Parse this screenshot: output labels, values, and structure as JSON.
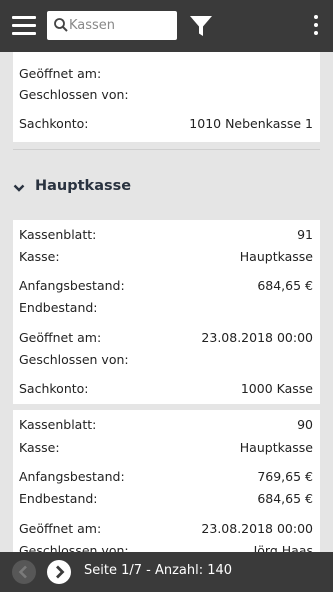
{
  "search": {
    "placeholder": "Kassen",
    "value": ""
  },
  "icons": {
    "menu": "hamburger-menu-icon",
    "search": "magnifier-icon",
    "filter": "funnel-icon",
    "more": "vertical-dots-icon",
    "section": "chevron-down-icon",
    "prev": "chevron-left-icon",
    "next": "chevron-right-icon"
  },
  "colors": {
    "topbar": "#3a3a3a",
    "background": "#e5e5e5",
    "card": "#ffffff",
    "section_title": "#2a3340"
  },
  "prev_card": {
    "opened_label": "Geöffnet am:",
    "closed_by_label": "Geschlossen von:",
    "account_label": "Sachkonto:",
    "account_value": "1010 Nebenkasse 1"
  },
  "section": {
    "title": "Hauptkasse"
  },
  "cards": [
    {
      "sheet_label": "Kassenblatt:",
      "sheet_value": "91",
      "register_label": "Kasse:",
      "register_value": "Hauptkasse",
      "opening_label": "Anfangsbestand:",
      "opening_value": "684,65 €",
      "ending_label": "Endbestand:",
      "ending_value": "",
      "opened_label": "Geöffnet am:",
      "opened_value": "23.08.2018 00:00",
      "closed_by_label": "Geschlossen von:",
      "closed_by_value": "",
      "account_label": "Sachkonto:",
      "account_value": "1000 Kasse"
    },
    {
      "sheet_label": "Kassenblatt:",
      "sheet_value": "90",
      "register_label": "Kasse:",
      "register_value": "Hauptkasse",
      "opening_label": "Anfangsbestand:",
      "opening_value": "769,65 €",
      "ending_label": "Endbestand:",
      "ending_value": "684,65 €",
      "opened_label": "Geöffnet am:",
      "opened_value": "23.08.2018 00:00",
      "closed_by_label": "Geschlossen von:",
      "closed_by_value": "Jörg Haas"
    }
  ],
  "footer": {
    "page_info": "Seite 1/7 - Anzahl: 140"
  }
}
